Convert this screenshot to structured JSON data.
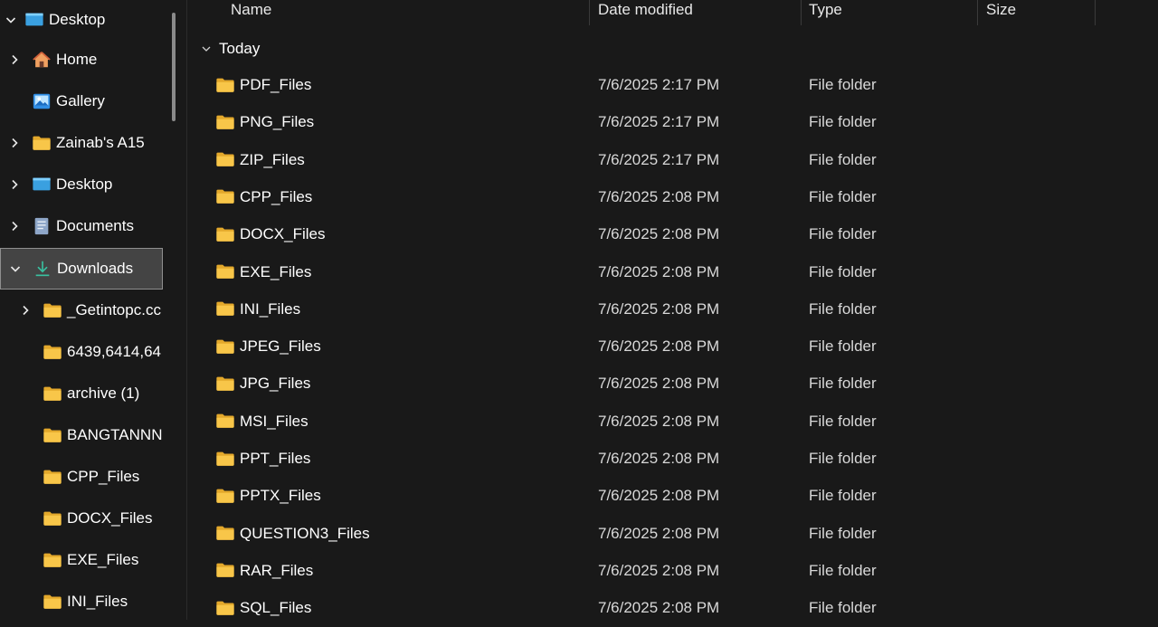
{
  "nav": {
    "items": [
      {
        "label": "Desktop",
        "icon": "desktop-icon",
        "chevron": "down",
        "indent": 0
      },
      {
        "label": "Home",
        "icon": "home-icon",
        "chevron": "right",
        "indent": 1
      },
      {
        "label": "Gallery",
        "icon": "gallery-icon",
        "chevron": "none",
        "indent": 1
      },
      {
        "label": "Zainab's A15",
        "icon": "folder-icon",
        "chevron": "right",
        "indent": 1
      },
      {
        "label": "Desktop",
        "icon": "desktop-icon",
        "chevron": "right",
        "indent": 1
      },
      {
        "label": "Documents",
        "icon": "documents-icon",
        "chevron": "right",
        "indent": 1
      },
      {
        "label": "Downloads",
        "icon": "download-icon",
        "chevron": "down",
        "indent": 1,
        "selected": true
      },
      {
        "label": "_Getintopc.cc",
        "icon": "folder-icon",
        "chevron": "right",
        "indent": 2
      },
      {
        "label": "6439,6414,64",
        "icon": "folder-icon",
        "chevron": "none",
        "indent": 2
      },
      {
        "label": "archive (1)",
        "icon": "folder-icon",
        "chevron": "none",
        "indent": 2
      },
      {
        "label": "BANGTANNN",
        "icon": "folder-icon",
        "chevron": "none",
        "indent": 2
      },
      {
        "label": "CPP_Files",
        "icon": "folder-icon",
        "chevron": "none",
        "indent": 2
      },
      {
        "label": "DOCX_Files",
        "icon": "folder-icon",
        "chevron": "none",
        "indent": 2
      },
      {
        "label": "EXE_Files",
        "icon": "folder-icon",
        "chevron": "none",
        "indent": 2
      },
      {
        "label": "INI_Files",
        "icon": "folder-icon",
        "chevron": "none",
        "indent": 2
      }
    ]
  },
  "columns": {
    "name": "Name",
    "date": "Date modified",
    "type": "Type",
    "size": "Size"
  },
  "group": {
    "label": "Today"
  },
  "files": [
    {
      "name": "PDF_Files",
      "date": "7/6/2025 2:17 PM",
      "type": "File folder"
    },
    {
      "name": "PNG_Files",
      "date": "7/6/2025 2:17 PM",
      "type": "File folder"
    },
    {
      "name": "ZIP_Files",
      "date": "7/6/2025 2:17 PM",
      "type": "File folder"
    },
    {
      "name": "CPP_Files",
      "date": "7/6/2025 2:08 PM",
      "type": "File folder"
    },
    {
      "name": "DOCX_Files",
      "date": "7/6/2025 2:08 PM",
      "type": "File folder"
    },
    {
      "name": "EXE_Files",
      "date": "7/6/2025 2:08 PM",
      "type": "File folder"
    },
    {
      "name": "INI_Files",
      "date": "7/6/2025 2:08 PM",
      "type": "File folder"
    },
    {
      "name": "JPEG_Files",
      "date": "7/6/2025 2:08 PM",
      "type": "File folder"
    },
    {
      "name": "JPG_Files",
      "date": "7/6/2025 2:08 PM",
      "type": "File folder"
    },
    {
      "name": "MSI_Files",
      "date": "7/6/2025 2:08 PM",
      "type": "File folder"
    },
    {
      "name": "PPT_Files",
      "date": "7/6/2025 2:08 PM",
      "type": "File folder"
    },
    {
      "name": "PPTX_Files",
      "date": "7/6/2025 2:08 PM",
      "type": "File folder"
    },
    {
      "name": "QUESTION3_Files",
      "date": "7/6/2025 2:08 PM",
      "type": "File folder"
    },
    {
      "name": "RAR_Files",
      "date": "7/6/2025 2:08 PM",
      "type": "File folder"
    },
    {
      "name": "SQL_Files",
      "date": "7/6/2025 2:08 PM",
      "type": "File folder"
    }
  ],
  "colors": {
    "background": "#191919",
    "folder": "#f8c649",
    "folder_dark": "#e3a82b",
    "selection": "#444444",
    "accent": "#3aa0e0"
  }
}
